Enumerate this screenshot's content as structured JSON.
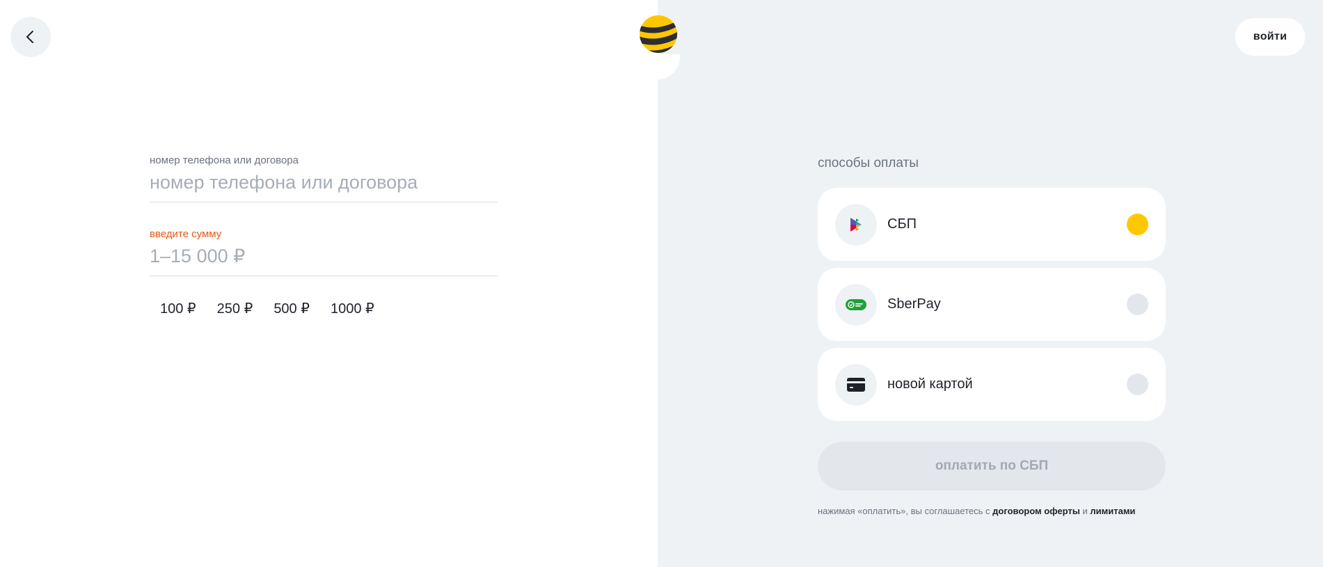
{
  "header": {
    "back_icon": "chevron-left-icon",
    "logo_icon": "beeline-logo",
    "login_label": "войти"
  },
  "form": {
    "account": {
      "label": "номер телефона или договора",
      "placeholder": "номер телефона или договора",
      "value": ""
    },
    "amount": {
      "label": "введите сумму",
      "placeholder": "1–15 000 ₽",
      "value": ""
    },
    "quick_amounts": [
      "100 ₽",
      "250 ₽",
      "500 ₽",
      "1000 ₽"
    ]
  },
  "payment": {
    "title": "способы оплаты",
    "methods": [
      {
        "label": "СБП",
        "icon": "sbp-icon",
        "selected": true
      },
      {
        "label": "SberPay",
        "icon": "sberpay-icon",
        "selected": false
      },
      {
        "label": "новой картой",
        "icon": "card-icon",
        "selected": false
      }
    ],
    "pay_button": "оплатить по СБП",
    "legal": {
      "prefix": "нажимая «оплатить», вы соглашаетесь с",
      "offer_link": "договором оферты",
      "and": "и",
      "limits_link": "лимитами"
    }
  },
  "colors": {
    "accent": "#ffc700",
    "error": "#e15a17",
    "panel_bg": "#eff2f5"
  }
}
